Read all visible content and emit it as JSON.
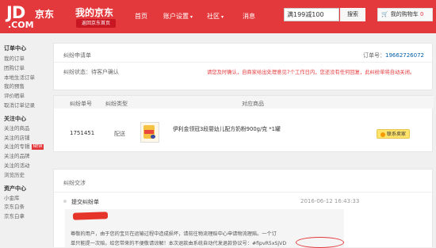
{
  "header": {
    "logo_text": "JD",
    "logo_cn": "京东",
    "logo_com": ".COM",
    "title": "我的京东",
    "back_home": "返回京东首页",
    "nav": [
      {
        "label": "首页",
        "dropdown": false
      },
      {
        "label": "账户设置",
        "dropdown": true
      },
      {
        "label": "社区",
        "dropdown": true
      },
      {
        "label": "消息",
        "dropdown": false
      }
    ],
    "search_value": "满199减100",
    "search_button": "搜索",
    "cart_label": "我的购物车",
    "cart_count": "0"
  },
  "sidebar": {
    "sections": [
      {
        "title": "订单中心",
        "items": [
          {
            "label": "我的订单"
          },
          {
            "label": "团购订单"
          },
          {
            "label": "本地生活订单"
          },
          {
            "label": "我的预售"
          },
          {
            "label": "评价晒单"
          },
          {
            "label": "取消订单记录"
          }
        ]
      },
      {
        "title": "关注中心",
        "items": [
          {
            "label": "关注的商品"
          },
          {
            "label": "关注的店铺"
          },
          {
            "label": "关注的专辑",
            "badge": "NEW"
          },
          {
            "label": "关注的品牌"
          },
          {
            "label": "关注的活动"
          },
          {
            "label": "浏览历史"
          }
        ]
      },
      {
        "title": "资产中心",
        "items": [
          {
            "label": "小金库"
          },
          {
            "label": "京东白条"
          },
          {
            "label": "京东白拿"
          }
        ]
      }
    ]
  },
  "dispute": {
    "heading": "纠纷申请单",
    "number_label": "订单号：",
    "number_value": "19662726072",
    "status_label": "纠纷状态：",
    "status_value": "待客户确认",
    "notice": "请您及时确认，自商家给出处理意见7个工作日内，您还没有任何回复，此纠纷单将自动关闭。"
  },
  "table": {
    "headers": [
      "纠纷单号",
      "纠纷类型",
      "对应商品"
    ],
    "row": {
      "id": "1751451",
      "type": "配送",
      "product": "伊利金领冠3段婴幼儿配方奶粉900g/克 *1罐",
      "contact_button": "联系卖家"
    }
  },
  "exchange": {
    "heading": "纠纷交涉",
    "event_label": "提交纠纷单",
    "event_time": "2016-06-12 16:43:33",
    "message_line1": "尊敬的用户，由于您的宝贝在运输过程中造成损坏，请前往物流理赔中心申请物流理赔。一个订",
    "message_line2": "单只能提一次赔，给您带来的不便敬请谅解！本次退款由系统自动代发退款协议号：",
    "message_code": "#fipvR5xSjVD"
  }
}
